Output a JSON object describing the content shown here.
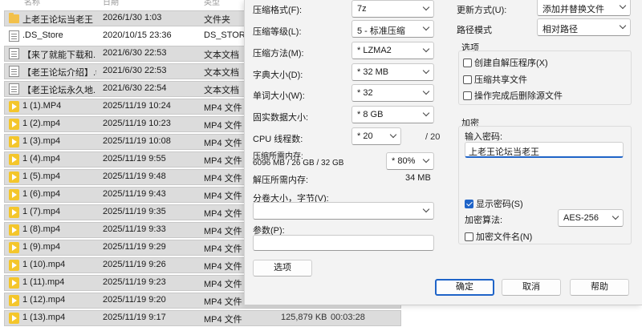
{
  "file_list": {
    "headers": {
      "name": "名称",
      "date": "日期",
      "type": "类型"
    },
    "rows": [
      {
        "icon": "folder-icon",
        "name": "上老王论坛当老王",
        "date": "2026/1/30 1:03",
        "type": "文件夹",
        "selected": true
      },
      {
        "icon": "document-icon",
        "name": ".DS_Store",
        "date": "2020/10/15 23:36",
        "type": "DS_STORE",
        "selected": false
      },
      {
        "icon": "document-icon",
        "name": "【来了就能下载和...",
        "date": "2021/6/30 22:53",
        "type": "文本文档",
        "selected": true
      },
      {
        "icon": "document-icon",
        "name": "【老王论坛介绍】.txt",
        "date": "2021/6/30 22:53",
        "type": "文本文档",
        "selected": true
      },
      {
        "icon": "document-icon",
        "name": "【老王论坛永久地...",
        "date": "2021/6/30 22:54",
        "type": "文本文档",
        "selected": true
      },
      {
        "icon": "video-icon",
        "name": "1 (1).MP4",
        "date": "2025/11/19 10:24",
        "type": "MP4 文件",
        "selected": true
      },
      {
        "icon": "video-icon",
        "name": "1 (2).mp4",
        "date": "2025/11/19 10:23",
        "type": "MP4 文件",
        "selected": true
      },
      {
        "icon": "video-icon",
        "name": "1 (3).mp4",
        "date": "2025/11/19 10:08",
        "type": "MP4 文件",
        "selected": true
      },
      {
        "icon": "video-icon",
        "name": "1 (4).mp4",
        "date": "2025/11/19 9:55",
        "type": "MP4 文件",
        "selected": true
      },
      {
        "icon": "video-icon",
        "name": "1 (5).mp4",
        "date": "2025/11/19 9:48",
        "type": "MP4 文件",
        "selected": true
      },
      {
        "icon": "video-icon",
        "name": "1 (6).mp4",
        "date": "2025/11/19 9:43",
        "type": "MP4 文件",
        "selected": true
      },
      {
        "icon": "video-icon",
        "name": "1 (7).mp4",
        "date": "2025/11/19 9:35",
        "type": "MP4 文件",
        "selected": true
      },
      {
        "icon": "video-icon",
        "name": "1 (8).mp4",
        "date": "2025/11/19 9:33",
        "type": "MP4 文件",
        "selected": true
      },
      {
        "icon": "video-icon",
        "name": "1 (9).mp4",
        "date": "2025/11/19 9:29",
        "type": "MP4 文件",
        "selected": true
      },
      {
        "icon": "video-icon",
        "name": "1 (10).mp4",
        "date": "2025/11/19 9:26",
        "type": "MP4 文件",
        "selected": true
      },
      {
        "icon": "video-icon",
        "name": "1 (11).mp4",
        "date": "2025/11/19 9:23",
        "type": "MP4 文件",
        "selected": true
      },
      {
        "icon": "video-icon",
        "name": "1 (12).mp4",
        "date": "2025/11/19 9:20",
        "type": "MP4 文件",
        "selected": true
      },
      {
        "icon": "video-icon",
        "name": "1 (13).mp4",
        "date": "2025/11/19 9:17",
        "type": "MP4 文件",
        "selected": true,
        "size": "125,879 KB",
        "duration": "00:03:28"
      }
    ]
  },
  "dialog": {
    "left": {
      "format": {
        "label": "压缩格式(F):",
        "value": "7z"
      },
      "level": {
        "label": "压缩等级(L):",
        "value": "5 - 标准压缩"
      },
      "method": {
        "label": "压缩方法(M):",
        "value": "* LZMA2"
      },
      "dict": {
        "label": "字典大小(D):",
        "value": "* 32 MB"
      },
      "word": {
        "label": "单词大小(W):",
        "value": "* 32"
      },
      "solid": {
        "label": "固实数据大小:",
        "value": "* 8 GB"
      },
      "cpu": {
        "label": "CPU 线程数:",
        "value": "* 20",
        "max": "/ 20"
      },
      "mem_compress": {
        "label": "压缩所需内存:",
        "detail": "6096 MB / 26 GB / 32 GB",
        "value": "* 80%"
      },
      "mem_decompress": {
        "label": "解压所需内存:",
        "value": "34 MB"
      },
      "split": {
        "label": "分卷大小，字节(V):",
        "value": ""
      },
      "params": {
        "label": "参数(P):",
        "value": ""
      },
      "options_button": "选项"
    },
    "right": {
      "update": {
        "label": "更新方式(U):",
        "value": "添加并替换文件"
      },
      "path_mode": {
        "label": "路径模式",
        "value": "相对路径"
      },
      "options_group": {
        "title": "选项",
        "items": [
          {
            "label": "创建自解压程序(X)",
            "checked": false
          },
          {
            "label": "压缩共享文件",
            "checked": false
          },
          {
            "label": "操作完成后删除源文件",
            "checked": false
          }
        ]
      },
      "encryption": {
        "title": "加密",
        "password_label": "输入密码:",
        "password_value": "上老王论坛当老王",
        "show_password": {
          "label": "显示密码(S)",
          "checked": true
        },
        "method_label": "加密算法:",
        "method_value": "AES-256",
        "encrypt_names": {
          "label": "加密文件名(N)",
          "checked": false
        }
      }
    },
    "buttons": {
      "ok": "确定",
      "cancel": "取消",
      "help": "帮助"
    },
    "accent_color": "#1f64c8"
  }
}
